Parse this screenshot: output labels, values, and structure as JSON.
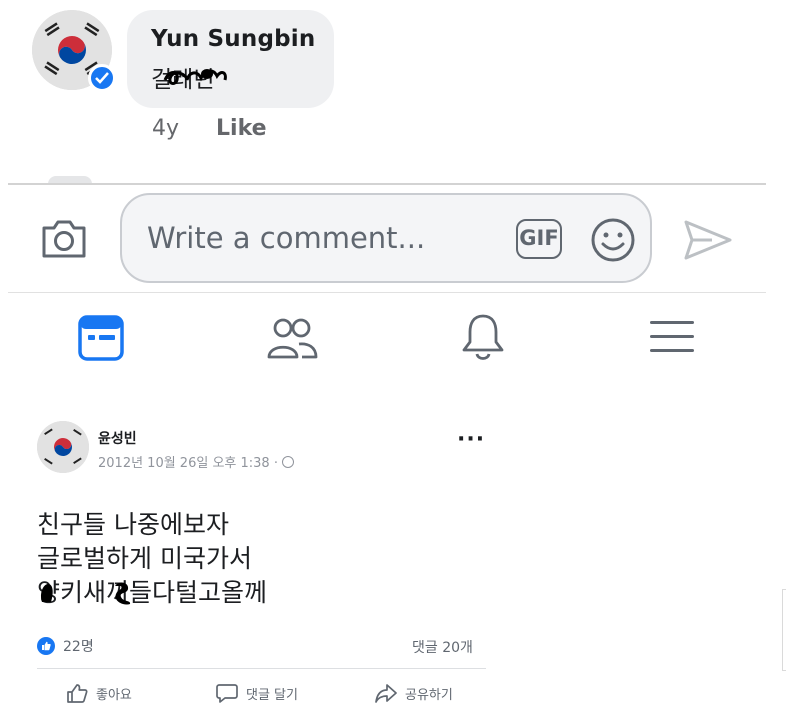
{
  "comment": {
    "author": "Yun Sungbin",
    "text": "걸레년",
    "time": "4y",
    "like_label": "Like"
  },
  "composer": {
    "placeholder": "Write a comment...",
    "gif_label": "GIF"
  },
  "nav": {
    "items": [
      "feed-icon",
      "friends-icon",
      "notifications-icon",
      "menu-icon"
    ],
    "active_color": "#1877f2"
  },
  "post": {
    "author": "윤성빈",
    "date": "2012년 10월 26일 오후 1:38 ·",
    "more_label": "···",
    "body_lines": [
      "친구들 나중에보자",
      "글로벌하게 미국가서",
      "양키새끼들다털고올께"
    ],
    "likes": "22명",
    "comments": "댓글 20개",
    "actions": {
      "like": "좋아요",
      "comment": "댓글 달기",
      "share": "공유하기"
    }
  },
  "colors": {
    "accent": "#1877f2",
    "bubble_bg": "#eff0f2",
    "muted_text": "#65676b"
  }
}
